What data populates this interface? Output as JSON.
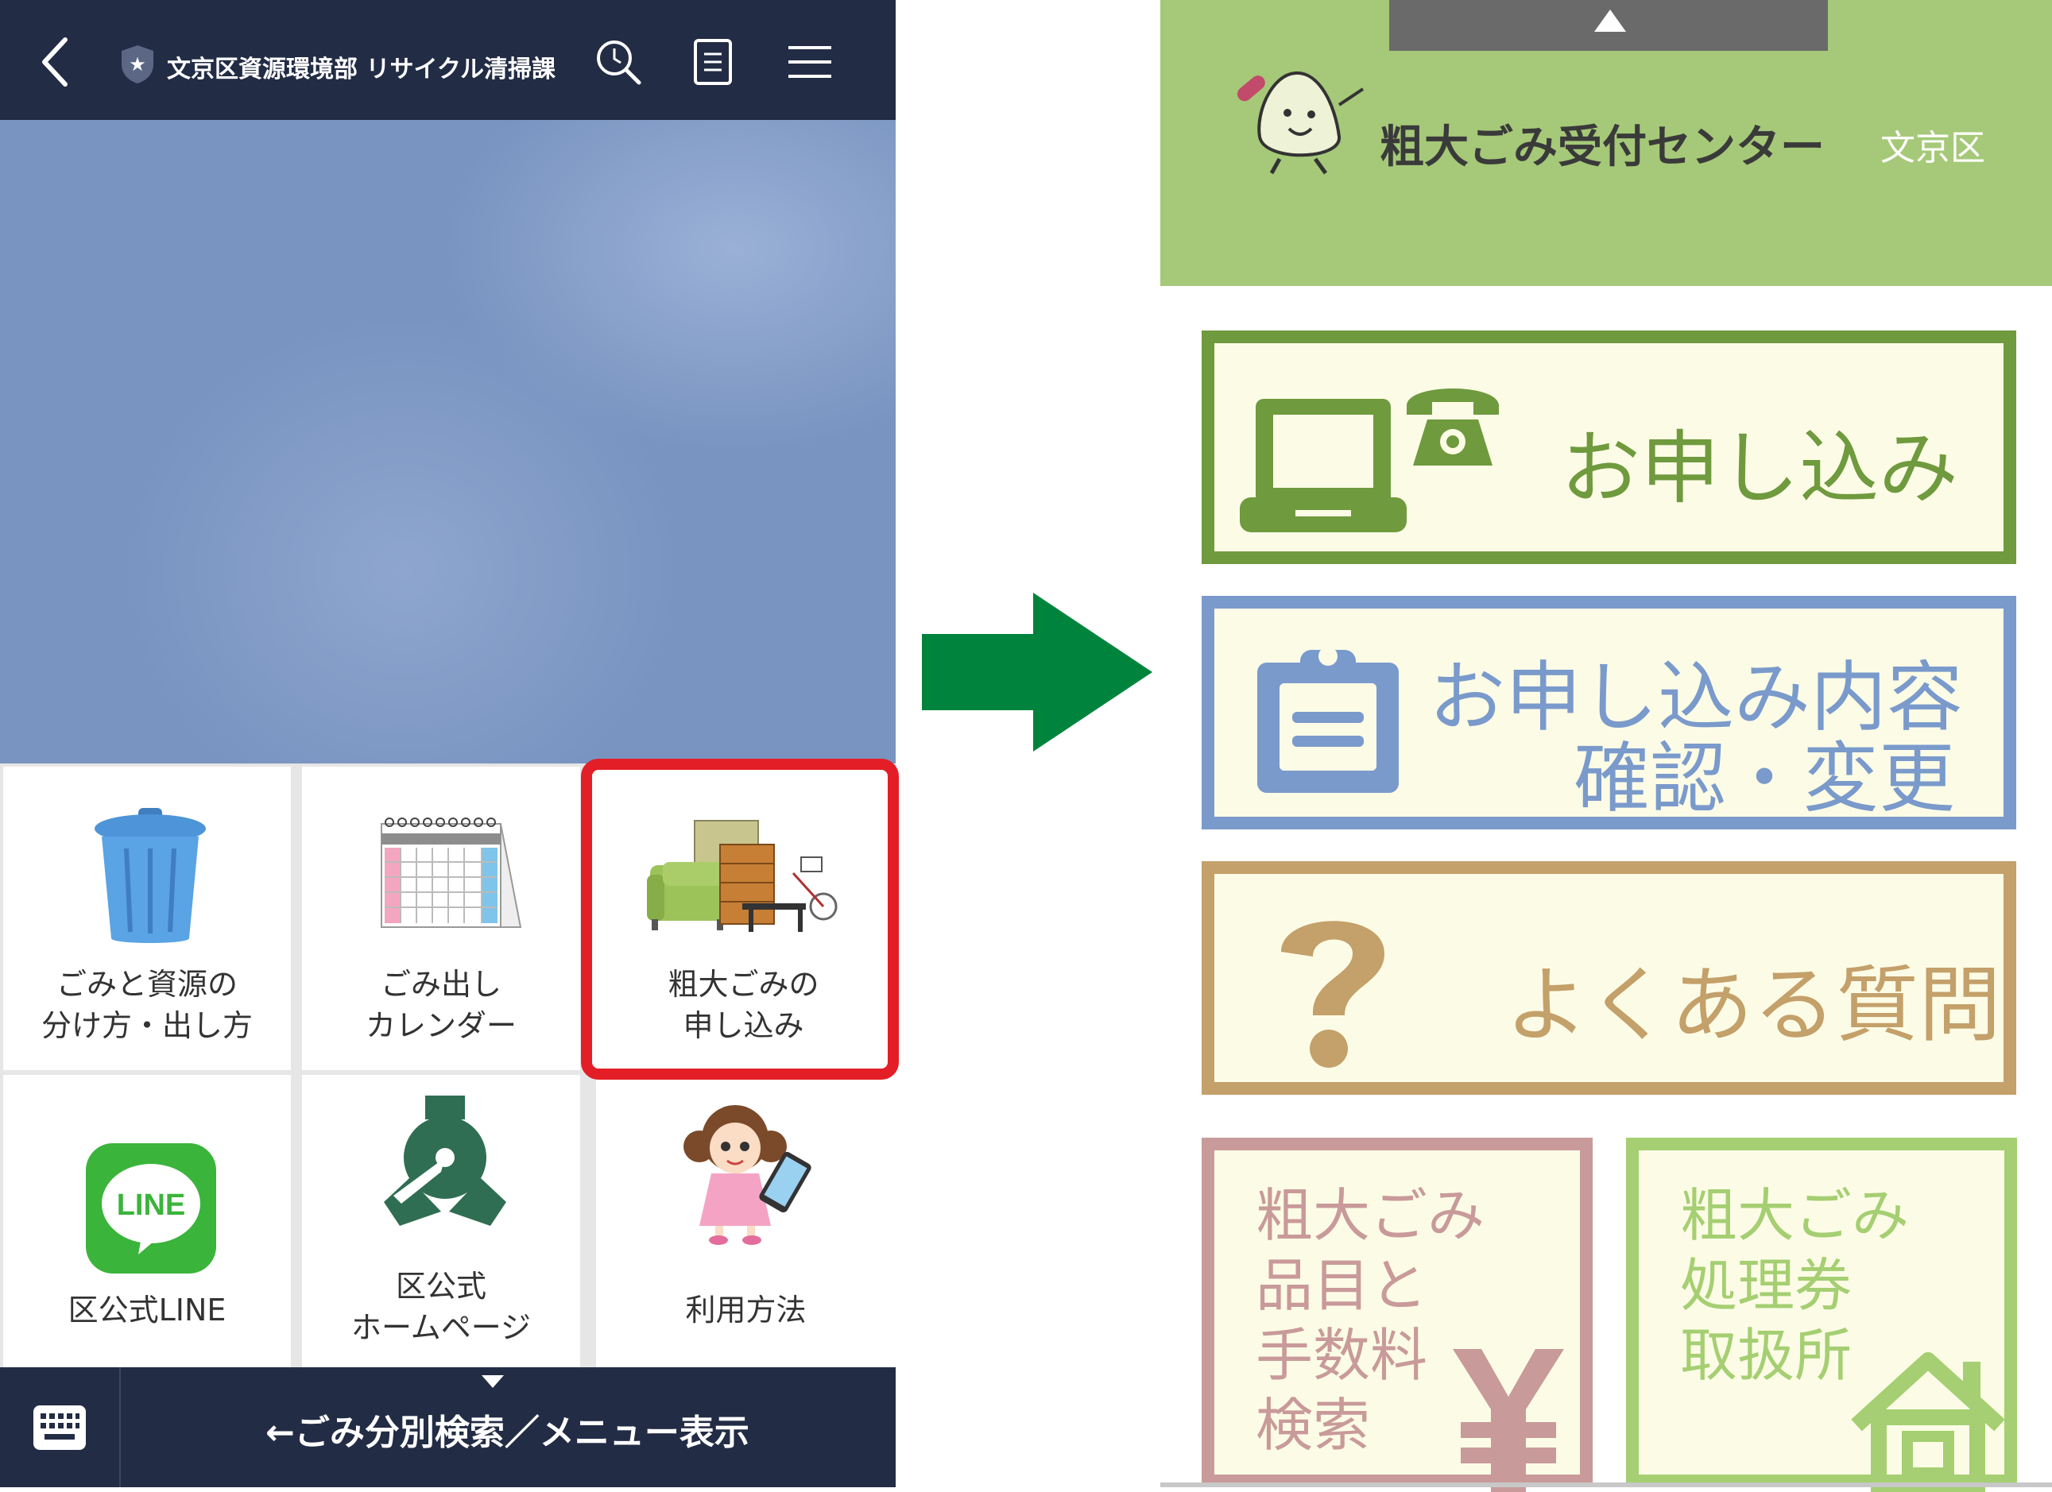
{
  "header": {
    "title": "文京区資源環境部 リサイクル清掃課",
    "icons": [
      "back-chevron-icon",
      "shield-icon",
      "search-icon",
      "notes-icon",
      "menu-icon"
    ]
  },
  "menu": {
    "items": [
      {
        "label1": "ごみと資源の",
        "label2": "分け方・出し方",
        "icon": "trash-can-icon"
      },
      {
        "label1": "ごみ出し",
        "label2": "カレンダー",
        "icon": "calendar-icon"
      },
      {
        "label1": "粗大ごみの",
        "label2": "申し込み",
        "icon": "bulky-waste-icon"
      },
      {
        "label1": "区公式LINE",
        "label2": "",
        "icon": "line-icon",
        "icon_text": "LINE"
      },
      {
        "label1": "区公式",
        "label2": "ホームページ",
        "icon": "ward-emblem-icon"
      },
      {
        "label1": "利用方法",
        "label2": "",
        "icon": "girl-with-phone-icon"
      }
    ]
  },
  "bottom_bar": {
    "text": "←ごみ分別検索／メニュー表示",
    "icon": "keyboard-icon"
  },
  "site": {
    "title": "粗大ごみ受付センター",
    "ward": "文京区",
    "buttons": {
      "apply": "お申し込み",
      "confirm_line1": "お申し込み内容",
      "confirm_line2": "確認・変更",
      "faq": "よくある質問",
      "search": "粗大ごみ\n品目と\n手数料\n検索",
      "tickets": "粗大ごみ\n処理券\n取扱所"
    }
  },
  "colors": {
    "header_bg": "#232c45",
    "highlight": "#e41e26",
    "arrow": "#00843d",
    "site_green": "#a5c978",
    "apply_border": "#6f9a3e",
    "confirm_border": "#7a9acb",
    "faq_border": "#c4a06a",
    "search_border": "#c99a9a",
    "ticket_border": "#a5cf72"
  }
}
